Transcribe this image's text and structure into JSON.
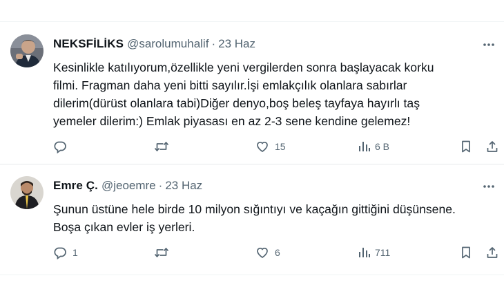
{
  "tweets": [
    {
      "display_name": "NEKSFİLİKS",
      "handle": "@sarolumuhalif",
      "separator": "·",
      "date": "23 Haz",
      "text": "Kesinlikle katılıyorum,özellikle yeni vergilerden sonra başlayacak korku\nfilmi. Fragman daha yeni bitti sayılır.İşi emlakçılık olanlara sabırlar\ndilerim(dürüst olanlara tabi)Diğer denyo,boş beleş tayfaya hayırlı taş\nyemeler dilerim:) Emlak piyasası en az 2-3 sene kendine gelemez!",
      "stats": {
        "replies": "",
        "reposts": "",
        "likes": "15",
        "views": "6 B"
      }
    },
    {
      "display_name": "Emre Ç.",
      "handle": "@jeoemre",
      "separator": "·",
      "date": "23 Haz",
      "text": "Şunun üstüne hele birde 10 milyon sığıntıyı ve kaçağın gittiğini düşünsene.\nBoşa çıkan evler iş yerleri.",
      "stats": {
        "replies": "1",
        "reposts": "",
        "likes": "6",
        "views": "711"
      }
    }
  ],
  "icons": {
    "more": "more-horizontal-icon",
    "reply": "reply-icon",
    "repost": "repost-icon",
    "like": "heart-icon",
    "views": "views-bar-chart-icon",
    "bookmark": "bookmark-icon",
    "share": "share-icon"
  },
  "colors": {
    "text": "#0f1419",
    "secondary": "#536471",
    "divider": "#eff3f4"
  }
}
